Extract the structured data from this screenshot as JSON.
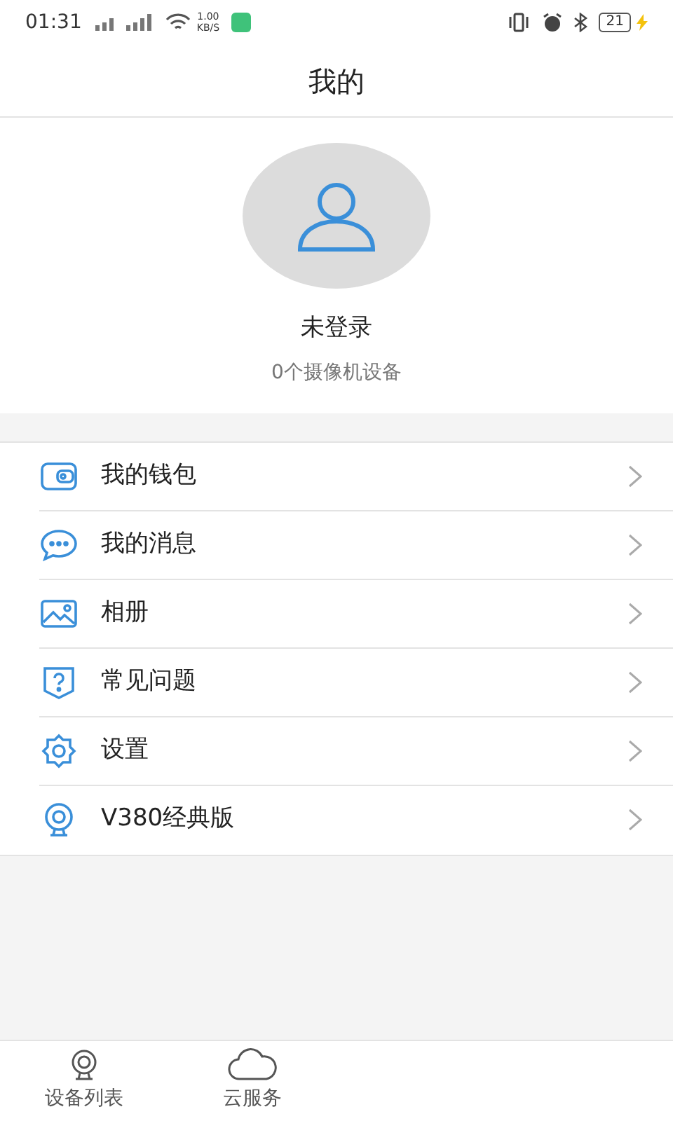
{
  "status_bar": {
    "time": "01:31",
    "speed": "1.00\nKB/S",
    "battery": "21"
  },
  "header": {
    "title": "我的"
  },
  "profile": {
    "name": "未登录",
    "subtitle": "0个摄像机设备"
  },
  "menu": [
    {
      "kind": "wallet",
      "label": "我的钱包"
    },
    {
      "kind": "message",
      "label": "我的消息"
    },
    {
      "kind": "album",
      "label": "相册"
    },
    {
      "kind": "faq",
      "label": "常见问题"
    },
    {
      "kind": "settings",
      "label": "设置"
    },
    {
      "kind": "camera",
      "label": "V380经典版"
    }
  ],
  "tabs": [
    {
      "kind": "camera",
      "label": "设备列表",
      "selected": false
    },
    {
      "kind": "cloud",
      "label": "云服务",
      "selected": false
    }
  ]
}
